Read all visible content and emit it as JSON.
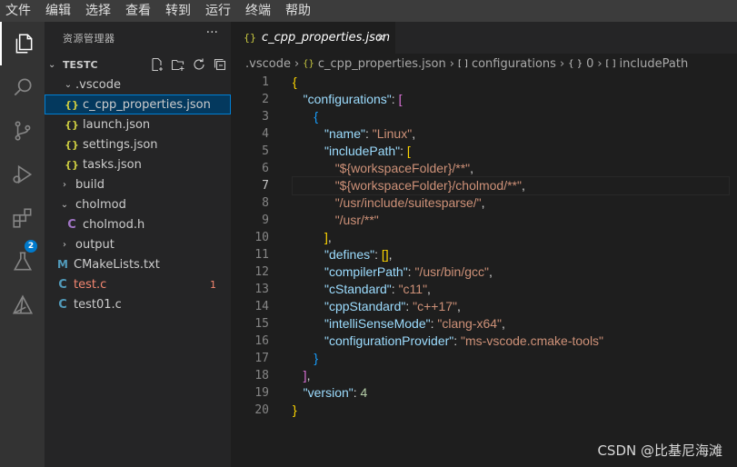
{
  "menu": [
    "文件",
    "编辑",
    "选择",
    "查看",
    "转到",
    "运行",
    "终端",
    "帮助"
  ],
  "activity": {
    "extensions_badge": "2"
  },
  "sidebar": {
    "title": "资源管理器",
    "more": "···",
    "section": "TESTC",
    "items": [
      {
        "label": ".vscode",
        "type": "folder-open"
      },
      {
        "label": "c_cpp_properties.json",
        "type": "json"
      },
      {
        "label": "launch.json",
        "type": "json"
      },
      {
        "label": "settings.json",
        "type": "json"
      },
      {
        "label": "tasks.json",
        "type": "json"
      },
      {
        "label": "build",
        "type": "folder"
      },
      {
        "label": "cholmod",
        "type": "folder-open"
      },
      {
        "label": "cholmod.h",
        "type": "h"
      },
      {
        "label": "output",
        "type": "folder"
      },
      {
        "label": "CMakeLists.txt",
        "type": "cmake"
      },
      {
        "label": "test.c",
        "type": "c",
        "errors": "1"
      },
      {
        "label": "test01.c",
        "type": "c"
      }
    ],
    "icons": {
      "json": "{}",
      "c": "C",
      "h": "C",
      "cmake": "M"
    }
  },
  "editor": {
    "tab_label": "c_cpp_properties.json",
    "tab_close": "×",
    "breadcrumb": [
      ".vscode",
      "c_cpp_properties.json",
      "configurations",
      "0",
      "includePath"
    ],
    "active_line": 7
  },
  "watermark": "CSDN @比基尼海滩",
  "colors": {
    "accent": "#007acc",
    "key": "#9cdcfe",
    "string": "#ce9178",
    "error": "#f48771"
  }
}
